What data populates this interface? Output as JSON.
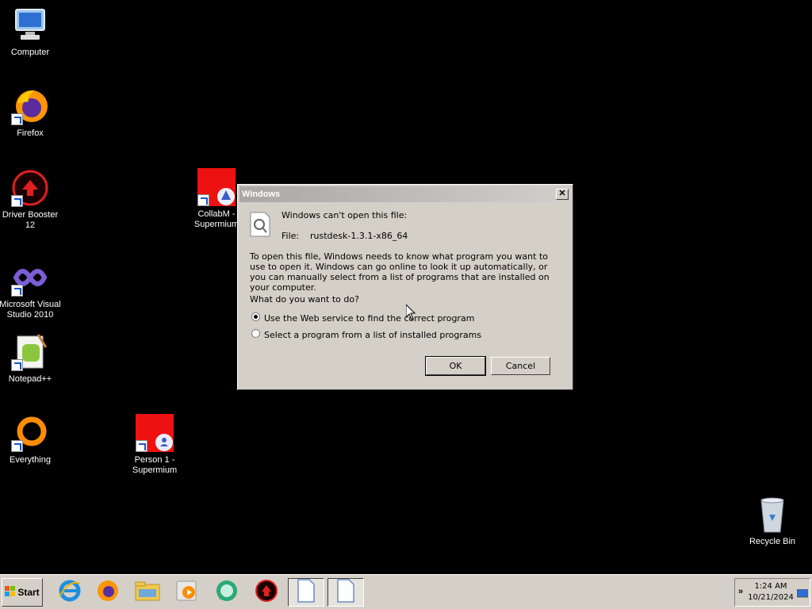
{
  "desktop": {
    "icons": {
      "computer": "Computer",
      "firefox": "Firefox",
      "driver_booster": "Driver Booster 12",
      "visual_studio": "Microsoft Visual Studio 2010",
      "notepadpp": "Notepad++",
      "everything": "Everything",
      "collabm": "CollabM - Supermium",
      "person1": "Person 1 - Supermium",
      "recycle_bin": "Recycle Bin"
    }
  },
  "dialog": {
    "title": "Windows",
    "heading": "Windows can't open this file:",
    "file_label": "File:",
    "file_name": "rustdesk-1.3.1-x86_64",
    "description": "To open this file, Windows needs to know what program you want to use to open it. Windows can go online to look it up automatically, or you can manually select from a list of programs that are installed on your computer.",
    "question": "What do you want to do?",
    "option_web": "Use the Web service to find the correct program",
    "option_list": "Select a program from a list of installed programs",
    "ok": "OK",
    "cancel": "Cancel",
    "close_glyph": "✕"
  },
  "taskbar": {
    "start_label": "Start",
    "clock_time": "1:24 AM",
    "clock_date": "10/21/2024",
    "tray_arrow": "»"
  },
  "colors": {
    "desktop_bg": "#000000",
    "dialog_bg": "#d4d0c8",
    "icon_red": "#ee1111"
  }
}
